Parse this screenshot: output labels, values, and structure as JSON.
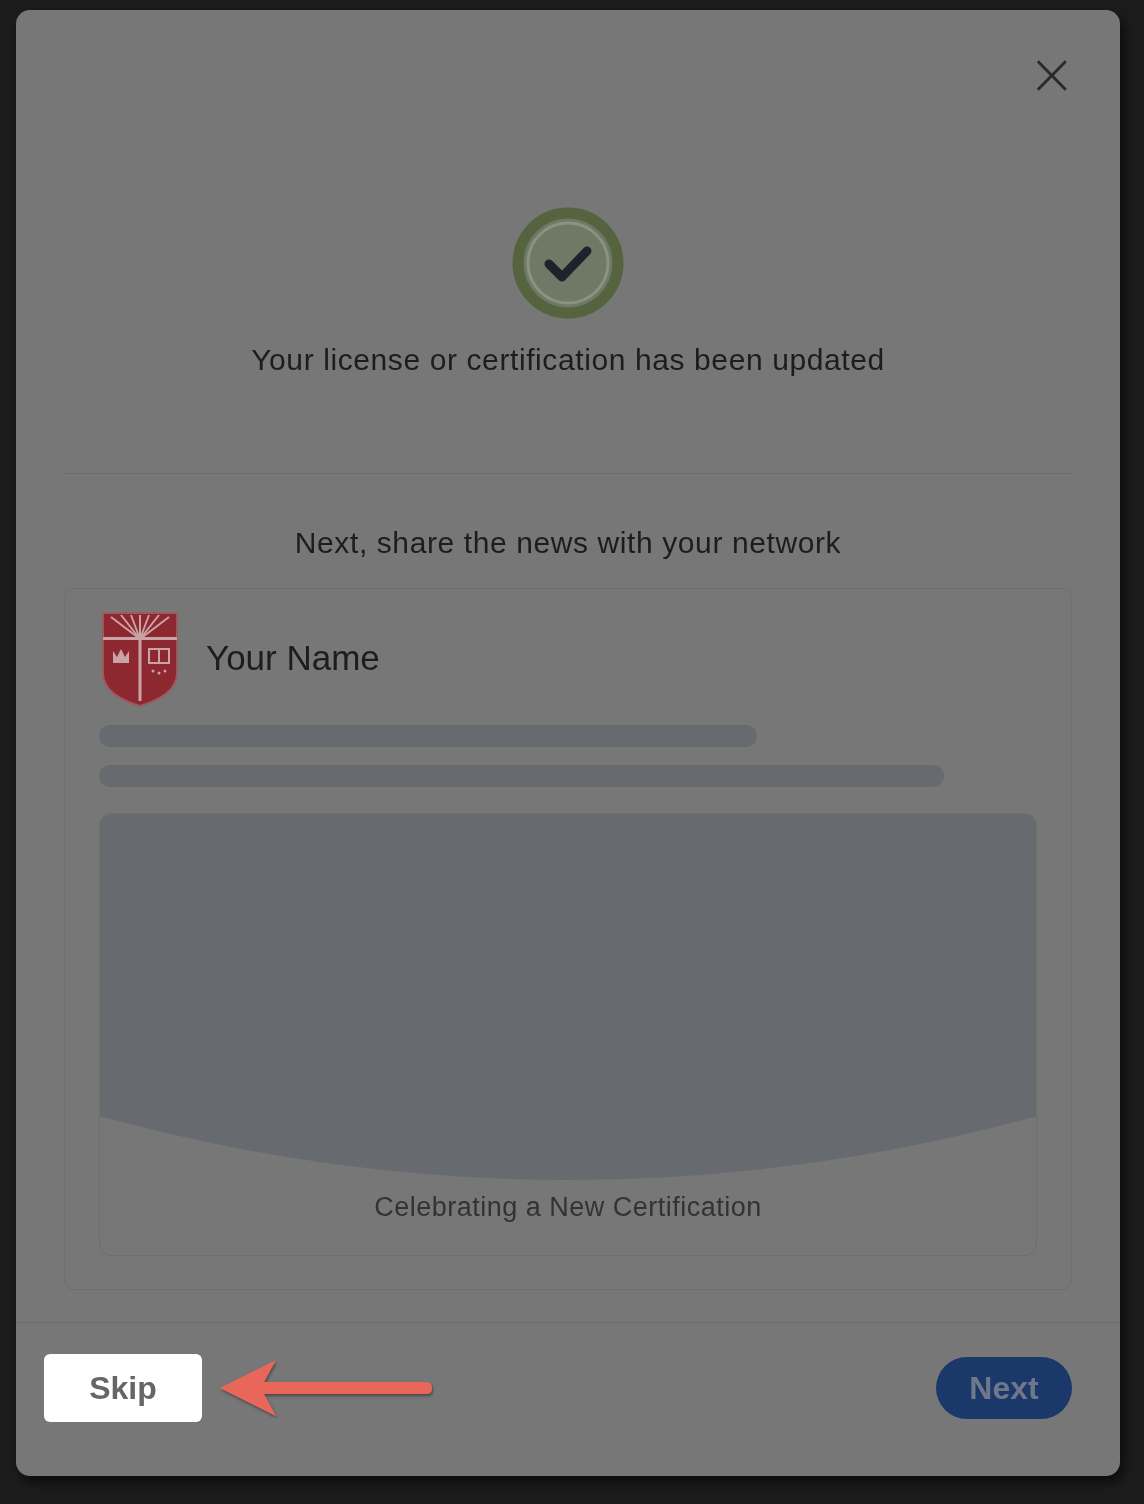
{
  "modal": {
    "close": "×",
    "title": "Your license or certification has been updated",
    "subtitle": "Next, share the news with your network",
    "preview": {
      "name": "Your Name",
      "caption": "Celebrating a New Certification"
    },
    "buttons": [
      {
        "label": "Skip",
        "kind": "secondary",
        "highlighted": true
      },
      {
        "label": "Next",
        "kind": "primary",
        "highlighted": false
      }
    ]
  }
}
